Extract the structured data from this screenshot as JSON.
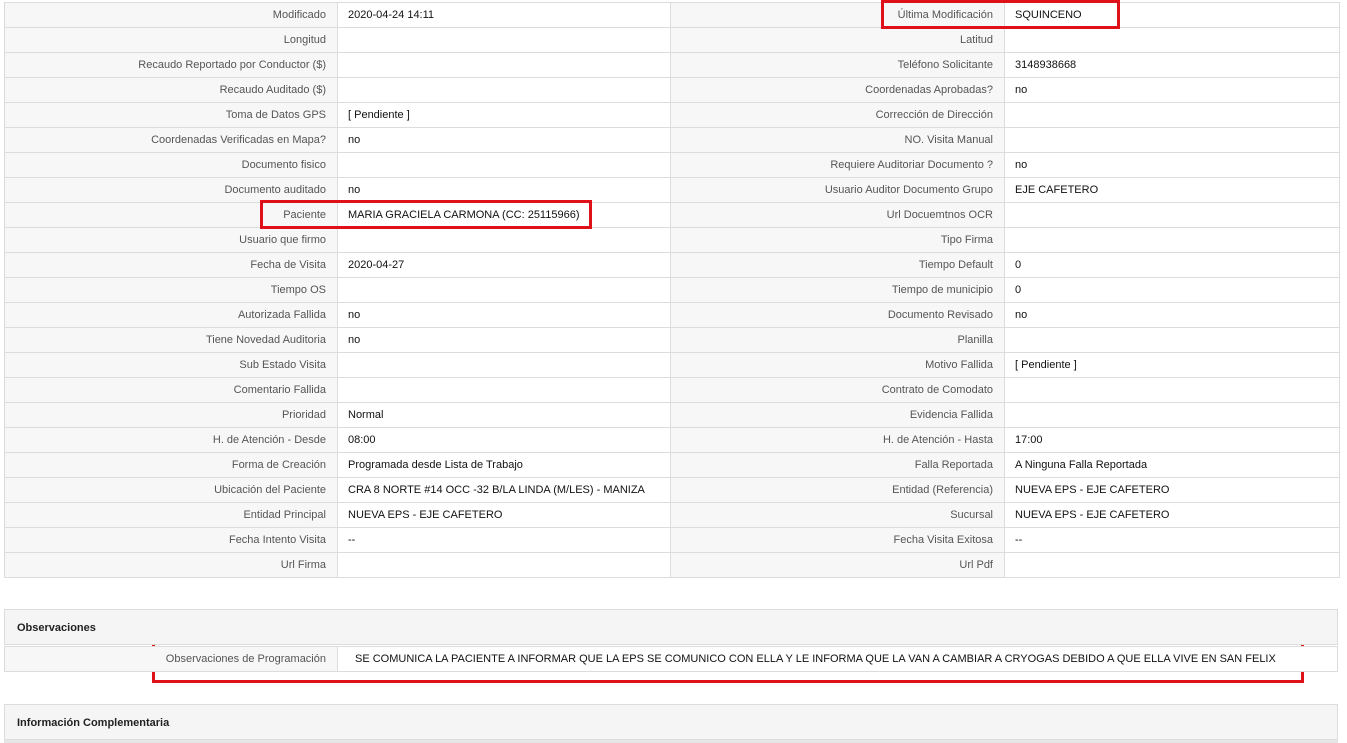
{
  "rows": [
    {
      "l1": "Modificado",
      "v1": "2020-04-24 14:11",
      "l2": "Última Modificación",
      "v2": "SQUINCENO"
    },
    {
      "l1": "Longitud",
      "v1": "",
      "l2": "Latitud",
      "v2": ""
    },
    {
      "l1": "Recaudo Reportado por Conductor ($)",
      "v1": "",
      "l2": "Teléfono Solicitante",
      "v2": "3148938668"
    },
    {
      "l1": "Recaudo Auditado ($)",
      "v1": "",
      "l2": "Coordenadas Aprobadas?",
      "v2": "no"
    },
    {
      "l1": "Toma de Datos GPS",
      "v1": "[ Pendiente ]",
      "l2": "Corrección de Dirección",
      "v2": ""
    },
    {
      "l1": "Coordenadas Verificadas en Mapa?",
      "v1": "no",
      "l2": "NO. Visita Manual",
      "v2": ""
    },
    {
      "l1": "Documento fisico",
      "v1": "",
      "l2": "Requiere Auditoriar Documento ?",
      "v2": "no"
    },
    {
      "l1": "Documento auditado",
      "v1": "no",
      "l2": "Usuario Auditor Documento Grupo",
      "v2": "EJE CAFETERO"
    },
    {
      "l1": "Paciente",
      "v1": "MARIA GRACIELA CARMONA (CC: 25115966)",
      "l2": "Url Docuemtnos OCR",
      "v2": ""
    },
    {
      "l1": "Usuario que firmo",
      "v1": "",
      "l2": "Tipo Firma",
      "v2": ""
    },
    {
      "l1": "Fecha de Visita",
      "v1": "2020-04-27",
      "l2": "Tiempo Default",
      "v2": "0"
    },
    {
      "l1": "Tiempo OS",
      "v1": "",
      "l2": "Tiempo de municipio",
      "v2": "0"
    },
    {
      "l1": "Autorizada Fallida",
      "v1": "no",
      "l2": "Documento Revisado",
      "v2": "no"
    },
    {
      "l1": "Tiene Novedad Auditoria",
      "v1": "no",
      "l2": "Planilla",
      "v2": ""
    },
    {
      "l1": "Sub Estado Visita",
      "v1": "",
      "l2": "Motivo Fallida",
      "v2": "[ Pendiente ]"
    },
    {
      "l1": "Comentario Fallida",
      "v1": "",
      "l2": "Contrato de Comodato",
      "v2": ""
    },
    {
      "l1": "Prioridad",
      "v1": "Normal",
      "l2": "Evidencia Fallida",
      "v2": ""
    },
    {
      "l1": "H. de Atención - Desde",
      "v1": "08:00",
      "l2": "H. de Atención - Hasta",
      "v2": "17:00"
    },
    {
      "l1": "Forma de Creación",
      "v1": "Programada desde Lista de Trabajo",
      "l2": "Falla Reportada",
      "v2": "A Ninguna Falla Reportada"
    },
    {
      "l1": "Ubicación del Paciente",
      "v1": "CRA 8 NORTE #14 OCC -32 B/LA LINDA (M/LES) - MANIZA",
      "l2": "Entidad (Referencia)",
      "v2": "NUEVA EPS - EJE CAFETERO"
    },
    {
      "l1": "Entidad Principal",
      "v1": "NUEVA EPS - EJE CAFETERO",
      "l2": "Sucursal",
      "v2": "NUEVA EPS - EJE CAFETERO"
    },
    {
      "l1": "Fecha Intento Visita",
      "v1": "--",
      "l2": "Fecha Visita Exitosa",
      "v2": "--"
    },
    {
      "l1": "Url Firma",
      "v1": "",
      "l2": "Url Pdf",
      "v2": ""
    }
  ],
  "observaciones": {
    "title": "Observaciones",
    "label": "Observaciones de Programación",
    "value": "SE COMUNICA LA PACIENTE A INFORMAR QUE LA EPS SE COMUNICO CON ELLA Y LE INFORMA QUE LA VAN A CAMBIAR A CRYOGAS DEBIDO A QUE ELLA VIVE EN SAN FELIX"
  },
  "complementaria": {
    "title": "Información Complementaria"
  },
  "colors": {
    "highlight": "#e0101a",
    "label_bg": "#f7f7f7",
    "border": "#dcdcdc"
  }
}
